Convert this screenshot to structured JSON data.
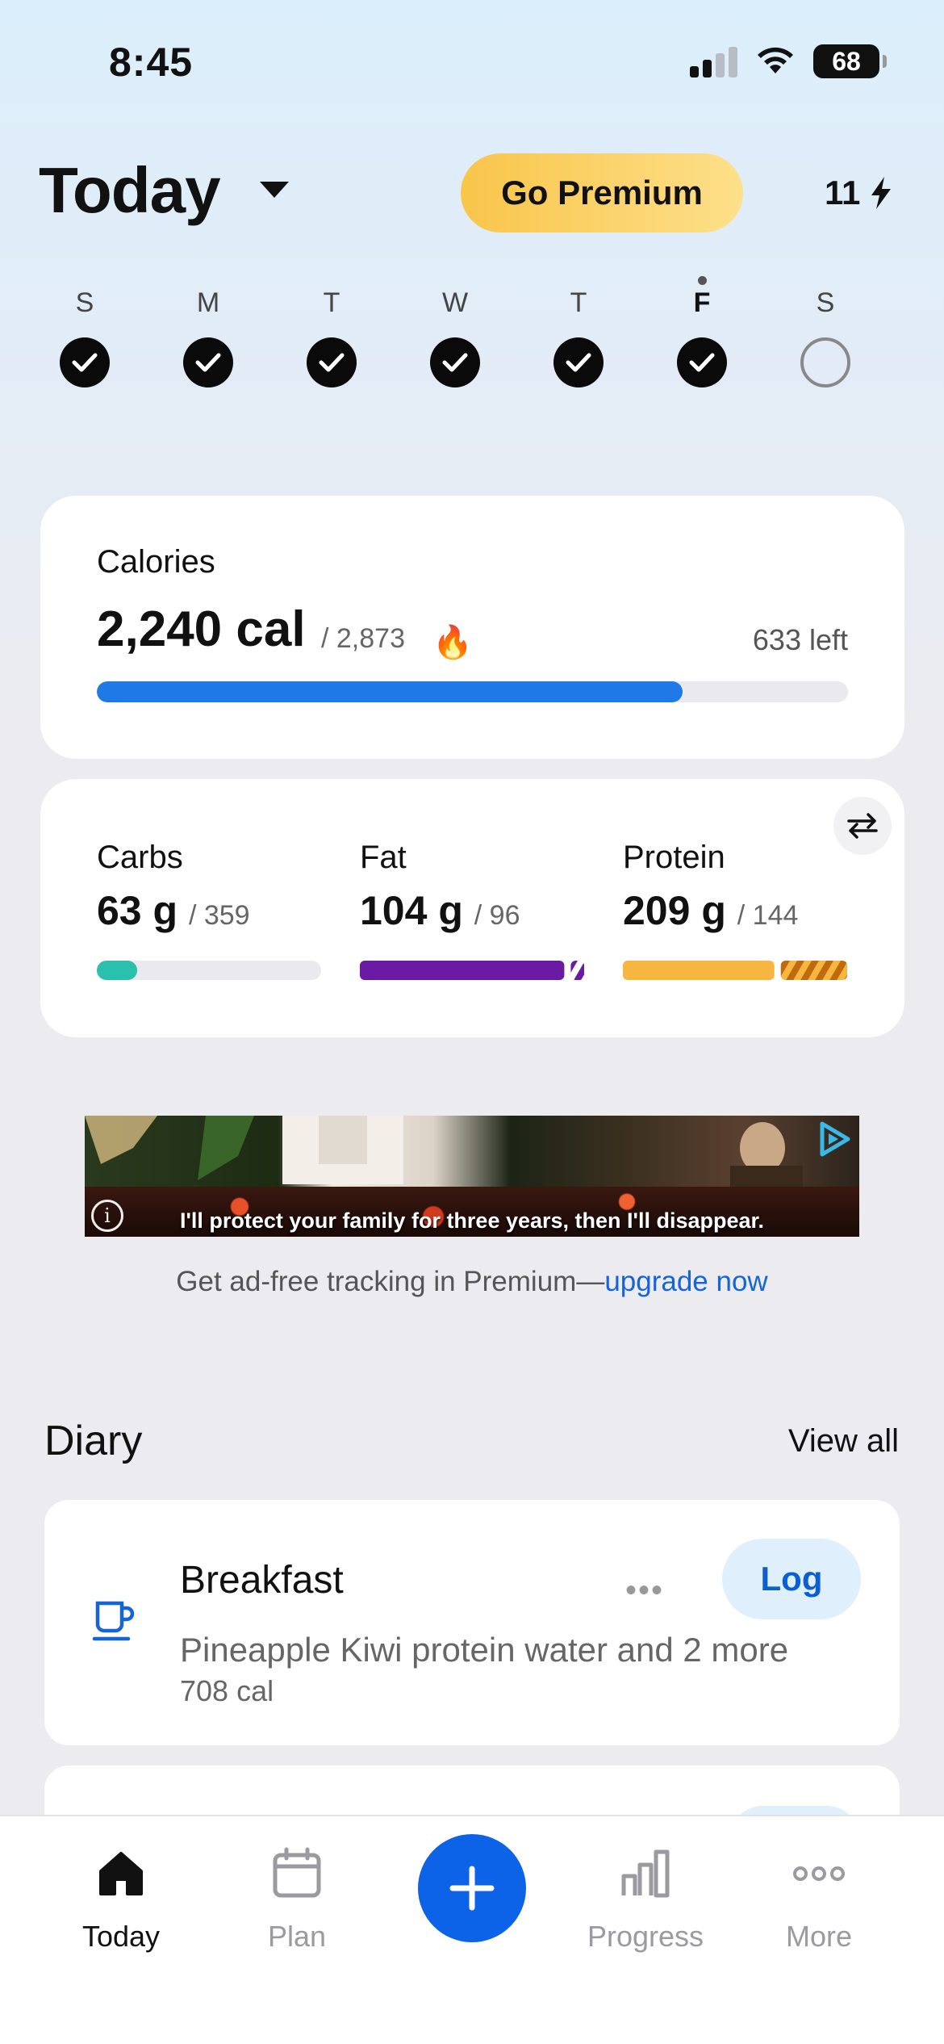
{
  "status": {
    "time": "8:45",
    "battery": "68"
  },
  "header": {
    "title": "Today",
    "premium_label": "Go Premium",
    "streak": "11"
  },
  "week": [
    {
      "letter": "S",
      "done": true
    },
    {
      "letter": "M",
      "done": true
    },
    {
      "letter": "T",
      "done": true
    },
    {
      "letter": "W",
      "done": true
    },
    {
      "letter": "T",
      "done": true
    },
    {
      "letter": "F",
      "done": true,
      "today": true
    },
    {
      "letter": "S",
      "done": false
    }
  ],
  "calories": {
    "label": "Calories",
    "value": "2,240 cal",
    "goal": "/ 2,873",
    "left": "633 left",
    "progress": 0.78,
    "color": "#1f7ae8"
  },
  "macros": [
    {
      "name": "Carbs",
      "value": "63 g",
      "goal": "/ 359",
      "progress": 0.18,
      "color": "#2bbfae"
    },
    {
      "name": "Fat",
      "value": "104 g",
      "goal": "/ 96",
      "progress": 1.08,
      "color": "#6b1ba3"
    },
    {
      "name": "Protein",
      "value": "209 g",
      "goal": "/ 144",
      "progress": 1.45,
      "color": "#f7b63f"
    }
  ],
  "ad": {
    "caption": "I'll protect your family for three years, then I'll disappear.",
    "note_text": "Get ad-free tracking in Premium—",
    "note_link": "upgrade now"
  },
  "diary": {
    "title": "Diary",
    "view_all": "View all",
    "meals": [
      {
        "name": "Breakfast",
        "icon": "coffee-cup-icon",
        "log_label": "Log",
        "description": "Pineapple Kiwi protein water and 2 more",
        "calories": "708 cal"
      }
    ]
  },
  "nav": {
    "items": [
      {
        "label": "Today",
        "icon": "home-icon",
        "active": true
      },
      {
        "label": "Plan",
        "icon": "calendar-icon",
        "active": false
      },
      {
        "label": "Progress",
        "icon": "bar-chart-icon",
        "active": false
      },
      {
        "label": "More",
        "icon": "more-dots-icon",
        "active": false
      }
    ],
    "add_icon": "plus-icon"
  },
  "colors": {
    "accent": "#0d63e8",
    "premium": "#f9c54a",
    "link": "#1565d8"
  }
}
